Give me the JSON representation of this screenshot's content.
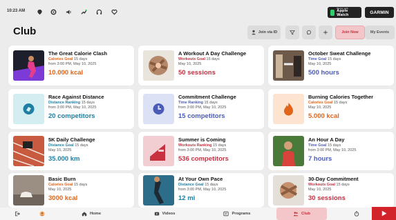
{
  "status_bar": {
    "time": "10:23 AM",
    "icons": [
      "location-icon",
      "settings-icon",
      "volume-icon",
      "activity-icon",
      "headphones-icon",
      "heart-icon"
    ],
    "apple_watch_small": "Works with",
    "apple_watch_label": "Apple Watch",
    "garmin_label": "GARMIN"
  },
  "header": {
    "title": "Club",
    "join_via_id": "Join via ID",
    "join_now": "Join Now",
    "my_events": "My Events"
  },
  "colors": {
    "calories": "#e0641a",
    "time": "#4a5bb8",
    "distance": "#1c7fa3",
    "workouts": "#c83040",
    "accent": "#d2232a"
  },
  "cards": [
    {
      "title": "The Great Calorie Clash",
      "kind": "Calories Goal",
      "duration": "15 days",
      "date": "from 3:00 PM, May 10, 2025",
      "value": "10.000 kcal",
      "category": "calories",
      "thumb": "photo-runner"
    },
    {
      "title": "A Workout A Day Challenge",
      "kind": "Workouts Goal",
      "duration": "15 days",
      "date": "May 10, 2025",
      "value": "50 sessions",
      "category": "workouts",
      "thumb": "photo-team"
    },
    {
      "title": "October Sweat Challenge",
      "kind": "Time Goal",
      "duration": "15 days",
      "date": "May 10, 2025",
      "value": "500 hours",
      "category": "time",
      "thumb": "photo-gym"
    },
    {
      "title": "Race Against Distance",
      "kind": "Distance Ranking",
      "duration": "15 days",
      "date": "from 3:00 PM, May 10, 2025",
      "value": "20 competitors",
      "category": "distance",
      "thumb": "icon-distance"
    },
    {
      "title": "Commitment Challenge",
      "kind": "Time Ranking",
      "duration": "15 days",
      "date": "from 3:00 PM, May 10, 2025",
      "value": "15 competitors",
      "category": "time",
      "thumb": "icon-time"
    },
    {
      "title": "Burning Calories Together",
      "kind": "Calories Goal",
      "duration": "15 days",
      "date": "May 10, 2025",
      "value": "5.000 kcal",
      "category": "calories",
      "thumb": "icon-flame"
    },
    {
      "title": "5K Daily Challenge",
      "kind": "Distance Goal",
      "duration": "15 days",
      "date": "May 10, 2025",
      "value": "35.000 km",
      "category": "distance",
      "thumb": "photo-track"
    },
    {
      "title": "Summer is Coming",
      "kind": "Workouts Ranking",
      "duration": "15 days",
      "date": "from 3:00 PM, May 10, 2025",
      "value": "536 competitors",
      "category": "workouts",
      "thumb": "icon-workouts"
    },
    {
      "title": "An Hour A Day",
      "kind": "Time Goal",
      "duration": "15 days",
      "date": "from 3:00 PM, May 10, 2025",
      "value": "7 hours",
      "category": "time",
      "thumb": "photo-kid"
    },
    {
      "title": "Basic Burn",
      "kind": "Calories Goal",
      "duration": "15 days",
      "date": "May 10, 2025",
      "value": "3000 kcal",
      "category": "calories",
      "thumb": "photo-shoes"
    },
    {
      "title": "At Your Own Pace",
      "kind": "Distance Goal",
      "duration": "15 days",
      "date": "from 3:00 PM, May 10, 2025",
      "value": "12 mi",
      "category": "distance",
      "thumb": "photo-sprint"
    },
    {
      "title": "30-Day Commitment",
      "kind": "Workouts Goal",
      "duration": "15 days",
      "date": "May 10, 2025",
      "value": "30 sessions",
      "category": "workouts",
      "thumb": "photo-hands"
    }
  ],
  "bottom_nav": {
    "home": "Home",
    "videos": "Videos",
    "programs": "Programs",
    "club": "Club"
  }
}
